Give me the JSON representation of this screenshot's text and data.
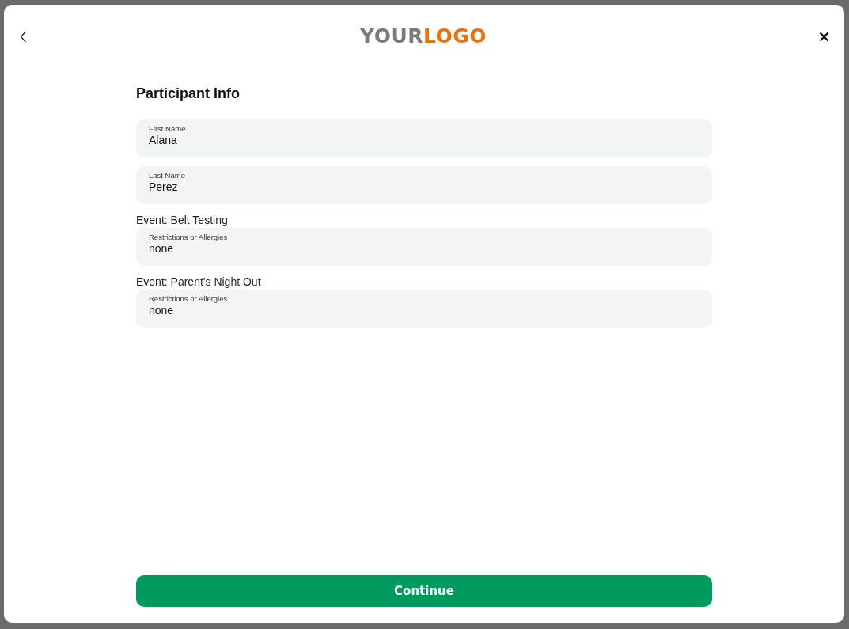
{
  "logo": [
    {
      "text": "YOUR",
      "color": "#7a7a7a"
    },
    {
      "text": "LOGO",
      "color": "#e8720c"
    }
  ],
  "title": "Participant Info",
  "fields": [
    {
      "label": "First Name",
      "value": "Alana"
    },
    {
      "label": "Last Name",
      "value": "Perez"
    }
  ],
  "events": [
    {
      "heading": "Event: Belt Testing",
      "field": {
        "label": "Restrictions or Allergies",
        "value": "none"
      }
    },
    {
      "heading": "Event: Parent's Night Out",
      "field": {
        "label": "Restrictions or Allergies",
        "value": "none"
      }
    }
  ],
  "continue_button": "Continue"
}
